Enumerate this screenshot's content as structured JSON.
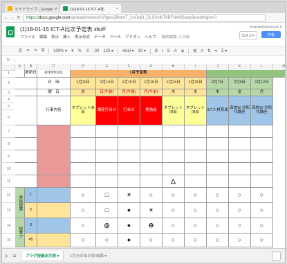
{
  "browser": {
    "tabs": [
      {
        "label": "マイドライブ - Google ドラ",
        "close": "×",
        "icon_color": "#f4b400"
      },
      {
        "label": "(1)18-01-15 ICT-A比",
        "close": "×",
        "icon_color": "#0f9d58"
      }
    ],
    "url_secure": "https://",
    "url_host": "docs.google.com",
    "url_rest": "/spreadsheets/d/1PglvxJ9kxmT_2oOsjO_DLSVxfbTABFN4dlSanp9o/edit#gid=0"
  },
  "doc": {
    "title": "(1)18-01-15 ICT-A比次予定表.xlsx",
    "star": "☆",
    "folder": "▣",
    "menus": [
      "ファイル",
      "編集",
      "表示",
      "挿入",
      "表示形式",
      "データ",
      "ツール",
      "アドオン",
      "ヘルプ",
      "最終編集: 3 日前"
    ],
    "account": "hmasaki@gmail.com ▾",
    "comments": "コメント",
    "share": "共有"
  },
  "toolbar": {
    "items": [
      "⎙",
      "↶",
      "↷",
      "⧉",
      "100% ▾",
      "¥",
      "%",
      ".0",
      ".00",
      "123 ▾",
      "Arial ▾",
      "10 ▾",
      "B",
      "I",
      "S",
      "A",
      "◈",
      "⊞",
      "≡",
      "⇅",
      "▾",
      "Σ ▾"
    ]
  },
  "formula_bar": {
    "fx": "fx",
    "value": ""
  },
  "grid": {
    "columns": [
      "",
      "A",
      "B",
      "C",
      "D",
      "E",
      "F",
      "G",
      "H",
      "I",
      "J",
      "K",
      "L",
      "M"
    ],
    "rows": [
      "1",
      "2",
      "3",
      "4",
      "5",
      "6",
      "7",
      "8",
      "9",
      "10",
      "11",
      "12",
      "13",
      "14",
      "15"
    ],
    "header_label_date": "更新日",
    "header_date_value": "2018/01/11",
    "month_banner": "1月予定表",
    "label_nichiji": "日　時",
    "label_youbi": "曜　日",
    "label_place": "行事内容",
    "dates": [
      "1月11日",
      "1月14日",
      "1月15日",
      "1月16日",
      "1月24日",
      "1月31日",
      "2月7日",
      "2月9日",
      "2月12日"
    ],
    "weekdays": [
      "木",
      "日(午前)",
      "月(午後)",
      "月(午前)",
      "木",
      "木",
      "木",
      "金",
      "月"
    ],
    "events": [
      "タブレット(B会",
      "講座打合せ",
      "打合せ",
      "勉強会",
      "タブレット(B会",
      "タブレット(B会",
      "ICT人材育成",
      "高校W 令和化講座",
      "高校W 令和化講座"
    ],
    "side_group_1": "黒板授業",
    "side_group_2": "授業ア",
    "row_numbers": [
      "1",
      "2",
      "3",
      "45"
    ],
    "marks_row_a": [
      "",
      "",
      "",
      "",
      "△",
      "",
      "",
      "",
      ""
    ],
    "marks_row_b": [
      "○",
      "□",
      "×",
      "○",
      "○",
      "○",
      "○",
      "○",
      "○"
    ],
    "marks_row_c": [
      "○",
      "□",
      "●",
      "×",
      "○",
      "○",
      "○",
      "○",
      "○"
    ],
    "marks_row_d": [
      "○",
      "◎",
      "●",
      "⊖",
      "○",
      "○",
      "○",
      "○",
      "○"
    ],
    "marks_row_e": [
      "○",
      "○",
      "●",
      "○",
      "○",
      "○",
      "○",
      "○",
      "○"
    ]
  },
  "sheetbar": {
    "add": "+",
    "list": "≡",
    "active_tab": "プラグ授業出欠表 ▾",
    "inactive_tab": "1月分の出欠表/成績 ▾"
  },
  "colors": {
    "banner_orange": "#f6b26b",
    "banner_green": "#93c47d",
    "header_yellow": "#ffe599",
    "header_light_green": "#b6d7a8",
    "event_red": "#ff0000",
    "event_blue": "#9fc5e8",
    "event_yellow": "#ffff99",
    "side_green": "#b6d7a8",
    "row_blue": "#9fc5e8",
    "row_yellow": "#ffe599",
    "row_pink": "#ea9999"
  }
}
